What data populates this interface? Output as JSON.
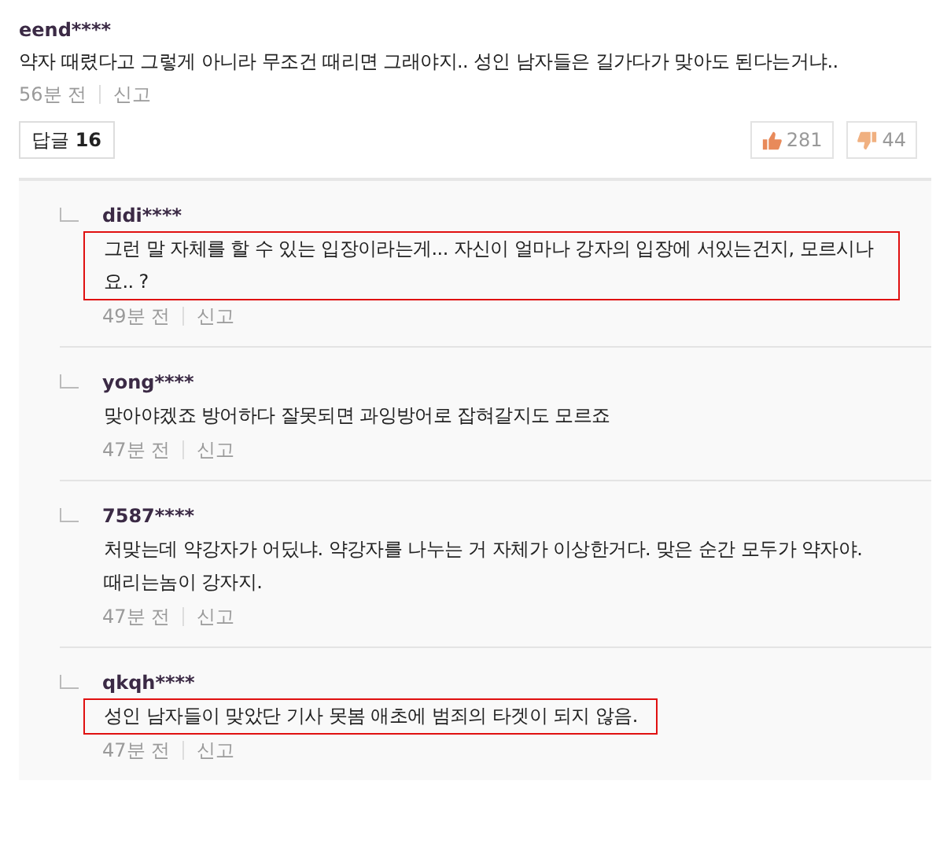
{
  "comment": {
    "username": "eend****",
    "body": "약자 때렸다고 그렇게 아니라 무조건 때리면 그래야지.. 성인 남자들은 길가다가 맞아도 된다는거냐..",
    "time": "56분 전",
    "report": "신고",
    "reply_label": "답글",
    "reply_count": "16",
    "likes": "281",
    "dislikes": "44"
  },
  "replies": [
    {
      "username": "didi****",
      "body": "그런 말 자체를 할 수 있는 입장이라는게... 자신이 얼마나 강자의 입장에 서있는건지, 모르시나요.. ?",
      "time": "49분 전",
      "report": "신고",
      "highlighted": true
    },
    {
      "username": "yong****",
      "body": "맞아야겠죠 방어하다 잘못되면 과잉방어로 잡혀갈지도 모르죠",
      "time": "47분 전",
      "report": "신고",
      "highlighted": false
    },
    {
      "username": "7587****",
      "body": "처맞는데 약강자가 어딨냐. 약강자를 나누는 거 자체가 이상한거다. 맞은 순간 모두가 약자야. 때리는놈이 강자지.",
      "time": "47분 전",
      "report": "신고",
      "highlighted": false
    },
    {
      "username": "qkqh****",
      "body": "성인 남자들이 맞았단 기사 못봄 애초에 범죄의 타겟이 되지 않음.",
      "time": "47분 전",
      "report": "신고",
      "highlighted": true
    }
  ]
}
